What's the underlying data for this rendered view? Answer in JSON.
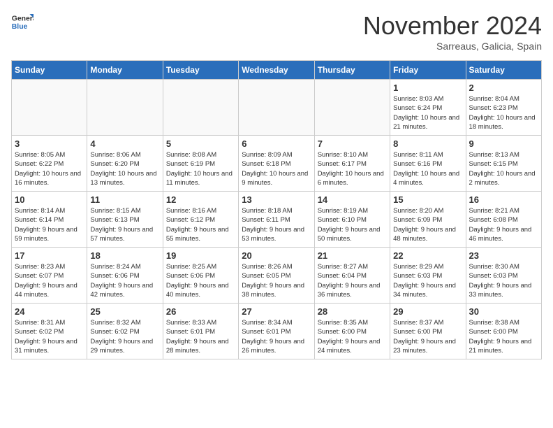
{
  "header": {
    "logo_line1": "General",
    "logo_line2": "Blue",
    "month_title": "November 2024",
    "location": "Sarreaus, Galicia, Spain"
  },
  "days_of_week": [
    "Sunday",
    "Monday",
    "Tuesday",
    "Wednesday",
    "Thursday",
    "Friday",
    "Saturday"
  ],
  "weeks": [
    [
      {
        "day": "",
        "info": ""
      },
      {
        "day": "",
        "info": ""
      },
      {
        "day": "",
        "info": ""
      },
      {
        "day": "",
        "info": ""
      },
      {
        "day": "",
        "info": ""
      },
      {
        "day": "1",
        "info": "Sunrise: 8:03 AM\nSunset: 6:24 PM\nDaylight: 10 hours and 21 minutes."
      },
      {
        "day": "2",
        "info": "Sunrise: 8:04 AM\nSunset: 6:23 PM\nDaylight: 10 hours and 18 minutes."
      }
    ],
    [
      {
        "day": "3",
        "info": "Sunrise: 8:05 AM\nSunset: 6:22 PM\nDaylight: 10 hours and 16 minutes."
      },
      {
        "day": "4",
        "info": "Sunrise: 8:06 AM\nSunset: 6:20 PM\nDaylight: 10 hours and 13 minutes."
      },
      {
        "day": "5",
        "info": "Sunrise: 8:08 AM\nSunset: 6:19 PM\nDaylight: 10 hours and 11 minutes."
      },
      {
        "day": "6",
        "info": "Sunrise: 8:09 AM\nSunset: 6:18 PM\nDaylight: 10 hours and 9 minutes."
      },
      {
        "day": "7",
        "info": "Sunrise: 8:10 AM\nSunset: 6:17 PM\nDaylight: 10 hours and 6 minutes."
      },
      {
        "day": "8",
        "info": "Sunrise: 8:11 AM\nSunset: 6:16 PM\nDaylight: 10 hours and 4 minutes."
      },
      {
        "day": "9",
        "info": "Sunrise: 8:13 AM\nSunset: 6:15 PM\nDaylight: 10 hours and 2 minutes."
      }
    ],
    [
      {
        "day": "10",
        "info": "Sunrise: 8:14 AM\nSunset: 6:14 PM\nDaylight: 9 hours and 59 minutes."
      },
      {
        "day": "11",
        "info": "Sunrise: 8:15 AM\nSunset: 6:13 PM\nDaylight: 9 hours and 57 minutes."
      },
      {
        "day": "12",
        "info": "Sunrise: 8:16 AM\nSunset: 6:12 PM\nDaylight: 9 hours and 55 minutes."
      },
      {
        "day": "13",
        "info": "Sunrise: 8:18 AM\nSunset: 6:11 PM\nDaylight: 9 hours and 53 minutes."
      },
      {
        "day": "14",
        "info": "Sunrise: 8:19 AM\nSunset: 6:10 PM\nDaylight: 9 hours and 50 minutes."
      },
      {
        "day": "15",
        "info": "Sunrise: 8:20 AM\nSunset: 6:09 PM\nDaylight: 9 hours and 48 minutes."
      },
      {
        "day": "16",
        "info": "Sunrise: 8:21 AM\nSunset: 6:08 PM\nDaylight: 9 hours and 46 minutes."
      }
    ],
    [
      {
        "day": "17",
        "info": "Sunrise: 8:23 AM\nSunset: 6:07 PM\nDaylight: 9 hours and 44 minutes."
      },
      {
        "day": "18",
        "info": "Sunrise: 8:24 AM\nSunset: 6:06 PM\nDaylight: 9 hours and 42 minutes."
      },
      {
        "day": "19",
        "info": "Sunrise: 8:25 AM\nSunset: 6:06 PM\nDaylight: 9 hours and 40 minutes."
      },
      {
        "day": "20",
        "info": "Sunrise: 8:26 AM\nSunset: 6:05 PM\nDaylight: 9 hours and 38 minutes."
      },
      {
        "day": "21",
        "info": "Sunrise: 8:27 AM\nSunset: 6:04 PM\nDaylight: 9 hours and 36 minutes."
      },
      {
        "day": "22",
        "info": "Sunrise: 8:29 AM\nSunset: 6:03 PM\nDaylight: 9 hours and 34 minutes."
      },
      {
        "day": "23",
        "info": "Sunrise: 8:30 AM\nSunset: 6:03 PM\nDaylight: 9 hours and 33 minutes."
      }
    ],
    [
      {
        "day": "24",
        "info": "Sunrise: 8:31 AM\nSunset: 6:02 PM\nDaylight: 9 hours and 31 minutes."
      },
      {
        "day": "25",
        "info": "Sunrise: 8:32 AM\nSunset: 6:02 PM\nDaylight: 9 hours and 29 minutes."
      },
      {
        "day": "26",
        "info": "Sunrise: 8:33 AM\nSunset: 6:01 PM\nDaylight: 9 hours and 28 minutes."
      },
      {
        "day": "27",
        "info": "Sunrise: 8:34 AM\nSunset: 6:01 PM\nDaylight: 9 hours and 26 minutes."
      },
      {
        "day": "28",
        "info": "Sunrise: 8:35 AM\nSunset: 6:00 PM\nDaylight: 9 hours and 24 minutes."
      },
      {
        "day": "29",
        "info": "Sunrise: 8:37 AM\nSunset: 6:00 PM\nDaylight: 9 hours and 23 minutes."
      },
      {
        "day": "30",
        "info": "Sunrise: 8:38 AM\nSunset: 6:00 PM\nDaylight: 9 hours and 21 minutes."
      }
    ]
  ]
}
